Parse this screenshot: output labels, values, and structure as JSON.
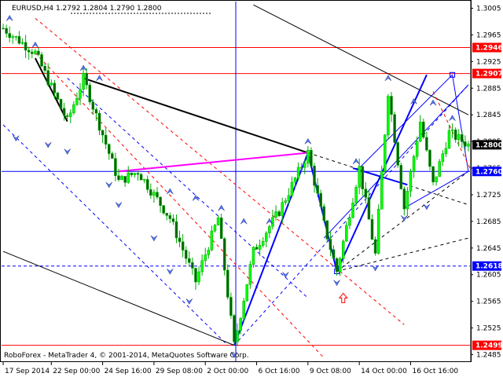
{
  "chart_data": {
    "type": "candlestick",
    "symbol_header": "EURUSD,H4  1.2792 1.2804 1.2790 1.2800",
    "copyright": "RoboForex - MetaTrader 4, © 2001-2014, MetaQuotes Software Corp.",
    "ylim": [
      1.2475,
      1.3015
    ],
    "y_ticks": [
      "1.3005",
      "1.2965",
      "1.2925",
      "1.2885",
      "1.2845",
      "1.2805",
      "1.2765",
      "1.2725",
      "1.2685",
      "1.2645",
      "1.2605",
      "1.2565",
      "1.2525",
      "1.2485"
    ],
    "x_labels": [
      "17 Sep 2014",
      "22 Sep 00:00",
      "24 Sep 16:00",
      "29 Sep 08:00",
      "2 Oct 00:00",
      "6 Oct 16:00",
      "9 Oct 08:00",
      "14 Oct 00:00",
      "16 Oct 16:00"
    ],
    "x_label_bars": [
      0,
      15,
      31,
      47,
      63,
      79,
      95,
      111,
      127
    ],
    "bar_count": 146,
    "price_tags": [
      {
        "label": "1.2946",
        "value": 1.2946,
        "color": "#ff0000"
      },
      {
        "label": "1.2907",
        "value": 1.2907,
        "color": "#ff0000"
      },
      {
        "label": "1.2800",
        "value": 1.28,
        "color": "#000000"
      },
      {
        "label": "1.2760",
        "value": 1.276,
        "color": "#0000ff"
      },
      {
        "label": "1.2618",
        "value": 1.2618,
        "color": "#0000ff"
      },
      {
        "label": "1.2499",
        "value": 1.2499,
        "color": "#ff0000"
      }
    ],
    "key_points": [
      {
        "bar": 0,
        "price": 1.2975
      },
      {
        "bar": 10,
        "price": 1.2938
      },
      {
        "bar": 20,
        "price": 1.2835
      },
      {
        "bar": 25,
        "price": 1.29
      },
      {
        "bar": 36,
        "price": 1.2745
      },
      {
        "bar": 42,
        "price": 1.276
      },
      {
        "bar": 52,
        "price": 1.269
      },
      {
        "bar": 60,
        "price": 1.2595
      },
      {
        "bar": 67,
        "price": 1.269
      },
      {
        "bar": 72,
        "price": 1.2499
      },
      {
        "bar": 78,
        "price": 1.264
      },
      {
        "bar": 86,
        "price": 1.27
      },
      {
        "bar": 95,
        "price": 1.2788
      },
      {
        "bar": 100,
        "price": 1.268
      },
      {
        "bar": 104,
        "price": 1.261
      },
      {
        "bar": 111,
        "price": 1.2765
      },
      {
        "bar": 116,
        "price": 1.2635
      },
      {
        "bar": 120,
        "price": 1.288
      },
      {
        "bar": 125,
        "price": 1.2705
      },
      {
        "bar": 130,
        "price": 1.2835
      },
      {
        "bar": 134,
        "price": 1.274
      },
      {
        "bar": 139,
        "price": 1.2818
      },
      {
        "bar": 145,
        "price": 1.28
      }
    ]
  }
}
